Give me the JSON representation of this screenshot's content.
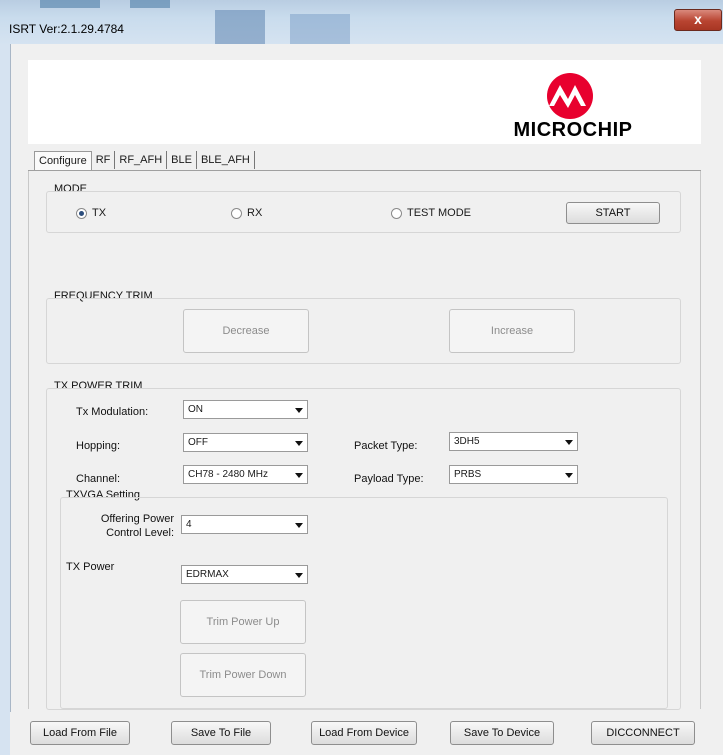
{
  "window": {
    "title": "ISRT Ver:2.1.29.4784",
    "close_label": "x"
  },
  "logo": {
    "text": "MICROCHIP",
    "brand_color": "#e8002e"
  },
  "tabs": [
    {
      "label": "Configure",
      "active": true
    },
    {
      "label": "RF"
    },
    {
      "label": "RF_AFH"
    },
    {
      "label": "BLE"
    },
    {
      "label": "BLE_AFH"
    }
  ],
  "mode": {
    "label": "MODE",
    "options": [
      {
        "label": "TX",
        "selected": true
      },
      {
        "label": "RX",
        "selected": false
      },
      {
        "label": "TEST MODE",
        "selected": false
      }
    ],
    "start_label": "START"
  },
  "frequency_trim": {
    "label": "FREQUENCY TRIM",
    "decrease_label": "Decrease",
    "increase_label": "Increase"
  },
  "tx_power_trim": {
    "label": "TX POWER TRIM",
    "tx_modulation": {
      "label": "Tx Modulation:",
      "value": "ON"
    },
    "hopping": {
      "label": "Hopping:",
      "value": "OFF"
    },
    "channel": {
      "label": "Channel:",
      "value": "CH78 - 2480 MHz"
    },
    "packet_type": {
      "label": "Packet Type:",
      "value": "3DH5"
    },
    "payload_type": {
      "label": "Payload Type:",
      "value": "PRBS"
    }
  },
  "txvga": {
    "label": "TXVGA Setting",
    "offering_power_label_1": "Offering Power",
    "offering_power_label_2": "Control Level:",
    "offering_power_value": "4",
    "tx_power_label": "TX Power",
    "tx_power_value": "EDRMAX",
    "trim_up_label": "Trim Power Up",
    "trim_down_label": "Trim Power Down"
  },
  "bottom": {
    "load_from_file": "Load From File",
    "save_to_file": "Save To File",
    "load_from_device": "Load From Device",
    "save_to_device": "Save To Device",
    "disconnect": "DICCONNECT"
  }
}
